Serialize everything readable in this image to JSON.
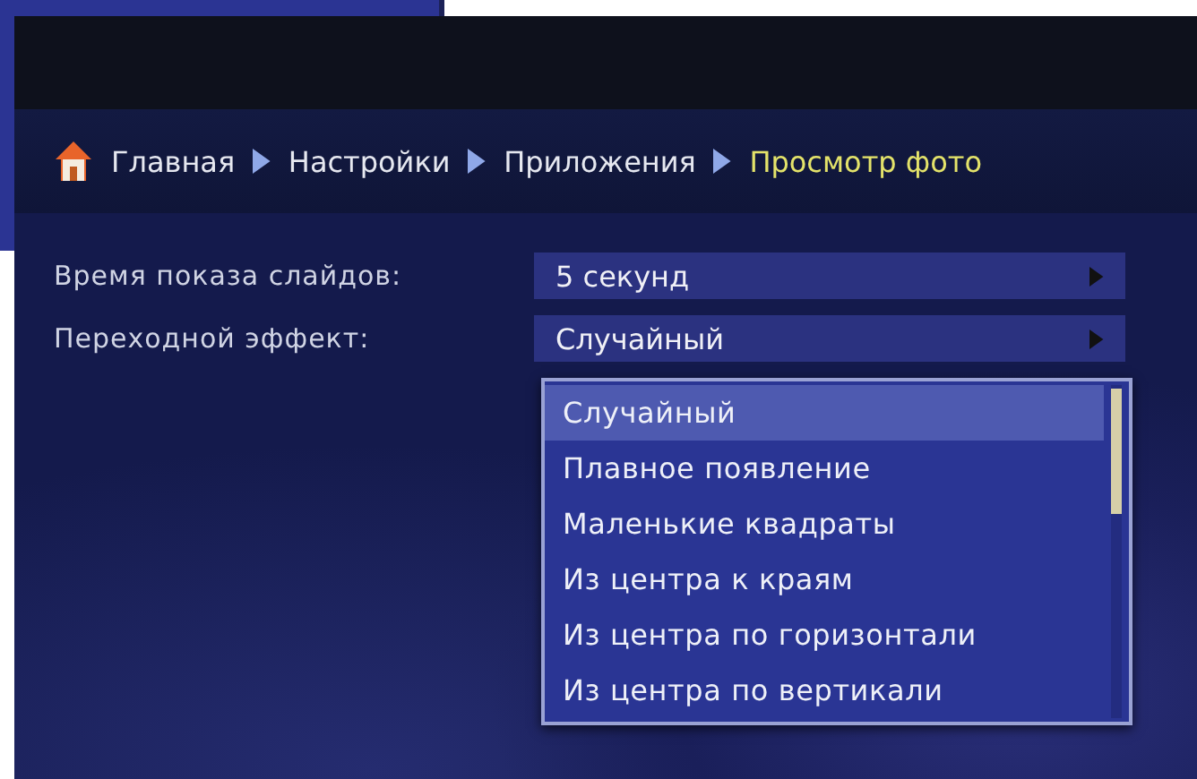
{
  "breadcrumb": [
    {
      "label": "Главная",
      "current": false
    },
    {
      "label": "Настройки",
      "current": false
    },
    {
      "label": "Приложения",
      "current": false
    },
    {
      "label": "Просмотр фото",
      "current": true
    }
  ],
  "settings": [
    {
      "label": "Время показа слайдов:",
      "value": "5 секунд"
    },
    {
      "label": "Переходной эффект:",
      "value": "Случайный"
    }
  ],
  "dropdown": {
    "options": [
      {
        "label": "Случайный",
        "selected": true
      },
      {
        "label": "Плавное появление",
        "selected": false
      },
      {
        "label": "Маленькие квадраты",
        "selected": false
      },
      {
        "label": "Из центра к краям",
        "selected": false
      },
      {
        "label": "Из центра по горизонтали",
        "selected": false
      },
      {
        "label": "Из центра по вертикали",
        "selected": false
      }
    ]
  }
}
